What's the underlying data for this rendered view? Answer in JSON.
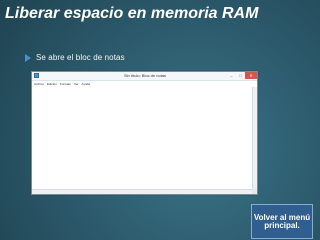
{
  "slide": {
    "title": "Liberar espacio en memoria RAM",
    "bullet": "Se abre el bloc de notas"
  },
  "notepad": {
    "window_title": "Sin título: Bloc de notas",
    "menu": [
      "Archivo",
      "Edición",
      "Formato",
      "Ver",
      "Ayuda"
    ],
    "controls": {
      "minimize": "–",
      "maximize": "□",
      "close": "✕"
    },
    "icon": "notepad-icon"
  },
  "navigation": {
    "back_label": "Volver al menú principal."
  },
  "colors": {
    "background": "#2d5c6e",
    "button_fill": "#2f5e8f",
    "button_border": "#87acd0",
    "bullet": "#4a90c6",
    "close_button": "#d9534f"
  }
}
